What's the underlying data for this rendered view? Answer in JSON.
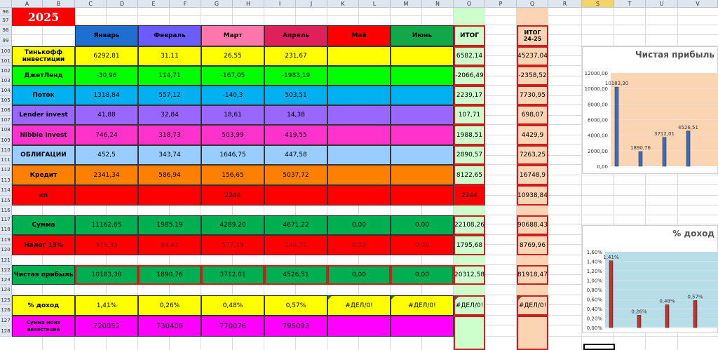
{
  "columns": [
    "A",
    "B",
    "C",
    "D",
    "E",
    "F",
    "G",
    "H",
    "I",
    "J",
    "K",
    "L",
    "M",
    "N",
    "O",
    "P",
    "Q",
    "R",
    "S",
    "T",
    "U",
    "V"
  ],
  "rows": [
    "96",
    "97",
    "98",
    "99",
    "100",
    "101",
    "102",
    "103",
    "104",
    "105",
    "106",
    "107",
    "108",
    "109",
    "110",
    "111",
    "112",
    "113",
    "114",
    "115",
    "116",
    "117",
    "118",
    "119",
    "120",
    "121",
    "122",
    "123",
    "124",
    "125",
    "126",
    "127",
    "128"
  ],
  "year": "2025",
  "months": [
    "Январь",
    "Февраль",
    "Март",
    "Апрель",
    "Май",
    "Июнь"
  ],
  "itog": "ИТОГ",
  "itog2425": "ИТОГ\n24-25",
  "table": [
    {
      "label": "Тинькофф инвестиции",
      "values": [
        "6292,81",
        "31,11",
        "26,55",
        "231,67",
        "",
        ""
      ],
      "itog": "6582,14",
      "itog2425": "45237,04",
      "color": "#ffff00"
    },
    {
      "label": "ДжетЛенд",
      "values": [
        "-30,96",
        "114,71",
        "-167,05",
        "-1983,19",
        "",
        ""
      ],
      "itog": "-2066,49",
      "itog2425": "-2358,52",
      "color": "#00ff00"
    },
    {
      "label": "Поток",
      "values": [
        "1318,84",
        "557,12",
        "-140,3",
        "503,51",
        "",
        ""
      ],
      "itog": "2239,17",
      "itog2425": "7730,95",
      "color": "#00b0f0"
    },
    {
      "label": "Lender invest",
      "values": [
        "41,88",
        "32,84",
        "18,61",
        "14,38",
        "",
        ""
      ],
      "itog": "107,71",
      "itog2425": "698,07",
      "color": "#9966ff"
    },
    {
      "label": "Nibble Invest",
      "values": [
        "746,24",
        "318,73",
        "503,99",
        "419,55",
        "",
        ""
      ],
      "itog": "1988,51",
      "itog2425": "4429,9",
      "color": "#ff33cc"
    },
    {
      "label": "ОБЛИГАЦИИ",
      "values": [
        "452,5",
        "343,74",
        "1646,75",
        "447,58",
        "",
        ""
      ],
      "itog": "2890,57",
      "itog2425": "7263,25",
      "color": "#99ccff"
    },
    {
      "label": "Кредит",
      "values": [
        "2341,34",
        "586,94",
        "156,65",
        "5037,72",
        "",
        ""
      ],
      "itog": "8122,65",
      "itog2425": "16748,9",
      "color": "#ff8000"
    },
    {
      "label": "кп",
      "values": [
        "",
        "",
        "2244",
        "",
        "",
        ""
      ],
      "itog": "2244",
      "itog2425": "10938,84",
      "color": "#ff0000"
    }
  ],
  "summa": {
    "label": "Сумма",
    "values": [
      "11162,65",
      "1985,19",
      "4289,20",
      "4671,22",
      "0,00",
      "0,00"
    ],
    "itog": "22108,26",
    "itog2425": "90688,43"
  },
  "nalog": {
    "label": "Налог 13%",
    "values": [
      "979,35",
      "94,43",
      "577,19",
      "144,71",
      "0,00",
      "0,00"
    ],
    "itog": "1795,68",
    "itog2425": "8769,96"
  },
  "chistaya": {
    "label": "Чистая прибыль",
    "values": [
      "10183,30",
      "1890,76",
      "3712,01",
      "4526,51",
      "0,00",
      "0,00"
    ],
    "itog": "20312,58",
    "itog2425": "81918,47"
  },
  "dohod": {
    "label": "% доход",
    "values": [
      "1,41%",
      "0,26%",
      "0,48%",
      "0,57%",
      "#ДЕЛ/0!",
      "#ДЕЛ/0!"
    ],
    "itog": "#ДЕЛ/0!",
    "itog2425": "#ДЕЛ/0!"
  },
  "summaInv": {
    "label": "Сумма моих инвестиций",
    "values": [
      "720052",
      "730409",
      "770076",
      "795093",
      "",
      ""
    ]
  },
  "colors": {
    "header_bg": "#dfe6f0",
    "selected_col": "#f4d36a",
    "itog_fill": "#ccffcc",
    "itog2425_fill": "#fbd4b4",
    "red_border": "#c8201e",
    "chart1_bg": "#fbd4b4",
    "chart2_bg": "#b7dde8"
  },
  "chart_data": [
    {
      "type": "bar",
      "title": "Чистая прибыль",
      "values": [
        10183.3,
        1890.76,
        3712.01,
        4526.51
      ],
      "data_labels": [
        "10183,30",
        "1890,76",
        "3712,01",
        "4526,51"
      ],
      "y_ticks": [
        "12000,00",
        "10000,00",
        "8000,00",
        "6000,00",
        "4000,00",
        "2000,00",
        "0,00"
      ],
      "ylim": [
        0,
        12000
      ]
    },
    {
      "type": "bar",
      "title": "% доход",
      "values": [
        1.41,
        0.26,
        0.48,
        0.57
      ],
      "data_labels": [
        "1,41%",
        "0,26%",
        "0,48%",
        "0,57%"
      ],
      "y_ticks": [
        "1,60%",
        "1,40%",
        "1,20%",
        "1,00%",
        "0,80%",
        "0,60%",
        "0,40%",
        "0,20%",
        "0,00%"
      ],
      "ylim": [
        0,
        1.6
      ]
    }
  ]
}
